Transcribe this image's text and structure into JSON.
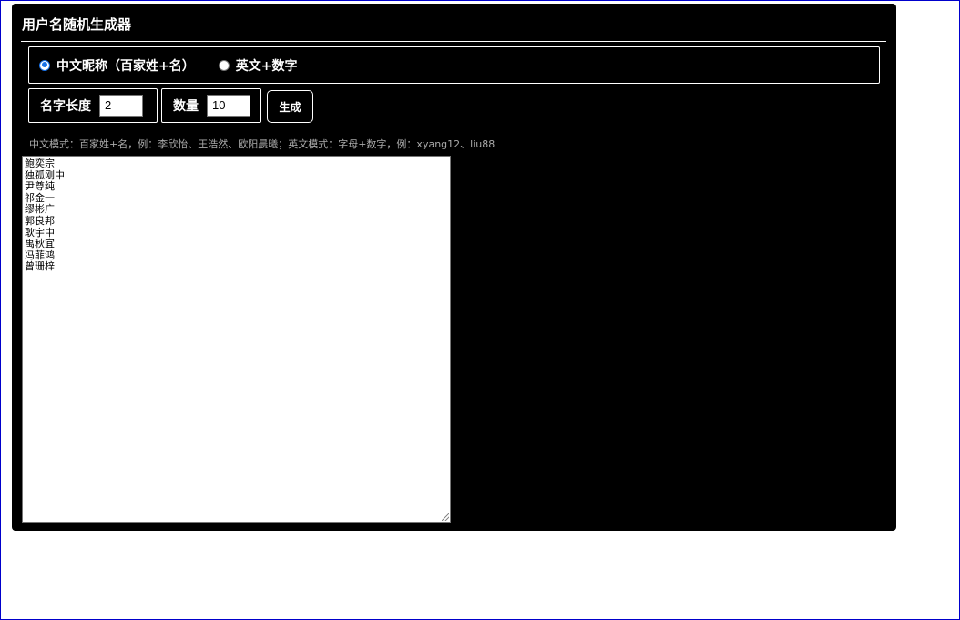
{
  "app": {
    "title": "用户名随机生成器"
  },
  "mode": {
    "options": [
      {
        "label": "中文昵称（百家姓+名）",
        "checked": true
      },
      {
        "label": "英文+数字",
        "checked": false
      }
    ]
  },
  "controls": {
    "name_length_label": "名字长度",
    "name_length_value": "2",
    "count_label": "数量",
    "count_value": "10",
    "generate_label": "生成"
  },
  "hint": "中文模式：百家姓+名，例：李欣怡、王浩然、欧阳晨曦；英文模式：字母+数字，例：xyang12、liu88",
  "output": {
    "lines": [
      "鲍奕宗",
      "独孤刚中",
      "尹尊纯",
      "祁金一",
      "缪彬广",
      "郭良邦",
      "耿宇中",
      "禹秋宜",
      "冯菲鸿",
      "曾珊梓"
    ]
  },
  "colors": {
    "panel_bg": "#000000",
    "radio_accent": "#1a73e8",
    "hint_text": "#aaaaaa"
  }
}
